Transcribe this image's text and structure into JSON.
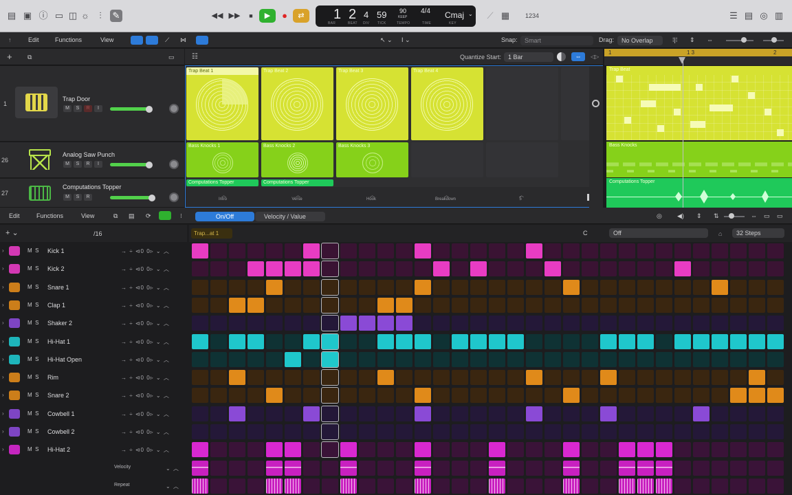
{
  "control_bar": {
    "lcd": {
      "bar": "1",
      "beat": "2",
      "div": "4",
      "tick": "59",
      "tempo": "90",
      "tempo_mode": "KEEP",
      "sig": "4/4",
      "key": "Cmaj",
      "labels": {
        "bar": "BAR",
        "beat": "BEAT",
        "div": "DIV",
        "tick": "TICK",
        "tempo": "TEMPO",
        "time": "TIME",
        "key": "KEY"
      }
    },
    "count_in": "1234"
  },
  "tracks_toolbar": {
    "edit": "Edit",
    "functions": "Functions",
    "view": "View",
    "snap_label": "Snap:",
    "snap_value": "Smart",
    "drag_label": "Drag:",
    "drag_value": "No Overlap"
  },
  "live_loops": {
    "quantize_label": "Quantize Start:",
    "quantize_value": "1 Bar",
    "scenes": [
      "Intro",
      "Verse",
      "Hook",
      "Breakdown",
      "5"
    ]
  },
  "tracks": [
    {
      "num": "1",
      "name": "Trap Door",
      "buttons": [
        "M",
        "S",
        "R",
        "I"
      ]
    },
    {
      "num": "26",
      "name": "Analog Saw Punch",
      "buttons": [
        "M",
        "S",
        "R",
        "I"
      ]
    },
    {
      "num": "27",
      "name": "Computations Topper",
      "buttons": [
        "M",
        "S",
        "R"
      ]
    }
  ],
  "cells": {
    "row1": [
      "Trap Beat 1",
      "Trap Beat 2",
      "Trap Beat 3",
      "Trap Beat 4"
    ],
    "row2": [
      "Bass Knocks 1",
      "Bass Knocks 2",
      "Bass Knocks 3"
    ],
    "row3": [
      "Computations Topper",
      "Computations Topper"
    ]
  },
  "regions": {
    "ruler": [
      "1",
      "1 3",
      "2"
    ],
    "trap": "Trap Beat",
    "bass": "Bass Knocks",
    "comp": "Computations Topper"
  },
  "step_seq": {
    "edit": "Edit",
    "functions": "Functions",
    "view": "View",
    "mode_onoff": "On/Off",
    "mode_velocity": "Velocity / Value",
    "rate": "/16",
    "pattern_name": "Trap...at 1",
    "key": "C",
    "scale": "Off",
    "steps": "32 Steps",
    "rows": [
      {
        "name": "Kick 1",
        "color": "#e83cc3"
      },
      {
        "name": "Kick 2",
        "color": "#e83cc3"
      },
      {
        "name": "Snare 1",
        "color": "#e08a1a"
      },
      {
        "name": "Clap 1",
        "color": "#e08a1a"
      },
      {
        "name": "Shaker 2",
        "color": "#8a4ad6"
      },
      {
        "name": "Hi-Hat 1",
        "color": "#1fc7cc"
      },
      {
        "name": "Hi-Hat Open",
        "color": "#1fc7cc"
      },
      {
        "name": "Rim",
        "color": "#e08a1a"
      },
      {
        "name": "Snare 2",
        "color": "#e08a1a"
      },
      {
        "name": "Cowbell 1",
        "color": "#8a4ad6"
      },
      {
        "name": "Cowbell 2",
        "color": "#8a4ad6"
      },
      {
        "name": "Hi-Hat 2",
        "color": "#d828d0"
      }
    ],
    "subrows": [
      "Velocity",
      "Repeat"
    ],
    "pattern": [
      [
        1,
        0,
        0,
        0,
        0,
        0,
        1,
        0,
        0,
        0,
        0,
        0,
        1,
        0,
        0,
        0,
        0,
        0,
        1,
        0,
        0,
        0,
        0,
        0,
        0,
        0,
        0,
        0,
        0,
        0,
        0,
        0
      ],
      [
        0,
        0,
        0,
        1,
        1,
        1,
        1,
        0,
        0,
        0,
        0,
        0,
        0,
        1,
        0,
        1,
        0,
        0,
        0,
        1,
        0,
        0,
        0,
        0,
        0,
        0,
        1,
        0,
        0,
        0,
        0,
        0
      ],
      [
        0,
        0,
        0,
        0,
        1,
        0,
        0,
        0,
        0,
        0,
        0,
        0,
        1,
        0,
        0,
        0,
        0,
        0,
        0,
        0,
        1,
        0,
        0,
        0,
        0,
        0,
        0,
        0,
        1,
        0,
        0,
        0
      ],
      [
        0,
        0,
        1,
        1,
        0,
        0,
        0,
        0,
        0,
        0,
        1,
        1,
        0,
        0,
        0,
        0,
        0,
        0,
        0,
        0,
        0,
        0,
        0,
        0,
        0,
        0,
        0,
        0,
        0,
        0,
        0,
        0
      ],
      [
        0,
        0,
        0,
        0,
        0,
        0,
        0,
        0,
        1,
        1,
        1,
        1,
        0,
        0,
        0,
        0,
        0,
        0,
        0,
        0,
        0,
        0,
        0,
        0,
        0,
        0,
        0,
        0,
        0,
        0,
        0,
        0
      ],
      [
        1,
        0,
        1,
        1,
        0,
        0,
        1,
        1,
        0,
        0,
        1,
        1,
        1,
        0,
        1,
        1,
        1,
        1,
        0,
        0,
        0,
        0,
        1,
        1,
        1,
        0,
        1,
        1,
        1,
        1,
        1,
        1
      ],
      [
        0,
        0,
        0,
        0,
        0,
        1,
        0,
        1,
        0,
        0,
        0,
        0,
        0,
        0,
        0,
        0,
        0,
        0,
        0,
        0,
        0,
        0,
        0,
        0,
        0,
        0,
        0,
        0,
        0,
        0,
        0,
        0
      ],
      [
        0,
        0,
        1,
        0,
        0,
        0,
        0,
        0,
        0,
        0,
        1,
        0,
        0,
        0,
        0,
        0,
        0,
        0,
        1,
        0,
        0,
        0,
        1,
        0,
        0,
        0,
        0,
        0,
        0,
        0,
        1,
        0
      ],
      [
        0,
        0,
        0,
        0,
        1,
        0,
        0,
        0,
        0,
        0,
        0,
        0,
        1,
        0,
        0,
        0,
        0,
        0,
        0,
        0,
        1,
        0,
        0,
        0,
        0,
        0,
        0,
        0,
        0,
        1,
        1,
        1
      ],
      [
        0,
        0,
        1,
        0,
        0,
        0,
        1,
        0,
        0,
        0,
        0,
        0,
        1,
        0,
        0,
        0,
        0,
        0,
        1,
        0,
        0,
        0,
        1,
        0,
        0,
        0,
        0,
        1,
        0,
        0,
        0,
        0
      ],
      [
        0,
        0,
        0,
        0,
        0,
        0,
        0,
        0,
        0,
        0,
        0,
        0,
        0,
        0,
        0,
        0,
        0,
        0,
        0,
        0,
        0,
        0,
        0,
        0,
        0,
        0,
        0,
        0,
        0,
        0,
        0,
        0
      ],
      [
        1,
        0,
        0,
        0,
        1,
        1,
        0,
        0,
        1,
        0,
        0,
        0,
        1,
        0,
        0,
        0,
        1,
        0,
        0,
        0,
        1,
        0,
        0,
        1,
        1,
        1,
        0,
        0,
        0,
        0,
        0,
        0
      ]
    ]
  }
}
